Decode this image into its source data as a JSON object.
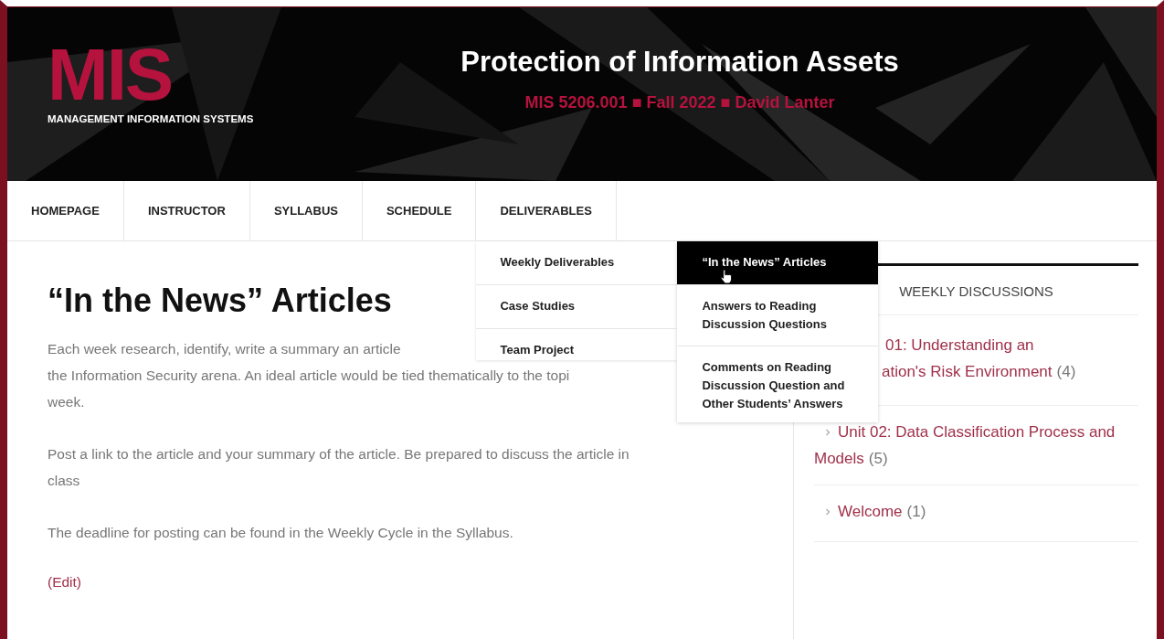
{
  "header": {
    "logo": "MIS",
    "logo_caption": "MANAGEMENT INFORMATION SYSTEMS",
    "title": "Protection of Information Assets",
    "subtitle": "MIS 5206.001 ■ Fall 2022 ■ David Lanter"
  },
  "nav": {
    "items": [
      {
        "label": "HOMEPAGE"
      },
      {
        "label": "INSTRUCTOR"
      },
      {
        "label": "SYLLABUS"
      },
      {
        "label": "SCHEDULE"
      },
      {
        "label": "DELIVERABLES",
        "expanded": true,
        "children": [
          {
            "label": "Weekly Deliverables",
            "expanded": true,
            "children": [
              {
                "label": "“In the News” Articles",
                "selected": true
              },
              {
                "label": "Answers to Reading Discussion Questions",
                "selected": false
              },
              {
                "label": "Comments on Reading Discussion Question and Other Students’ Answers",
                "selected": false
              }
            ]
          },
          {
            "label": "Case Studies"
          },
          {
            "label": "Team Project"
          }
        ]
      }
    ]
  },
  "page": {
    "title": "“In the News” Articles",
    "paragraphs": [
      [
        "Each week research, identify, write a summary an article",
        "the Information Security arena. An ideal article would be tied thematically to the topi",
        "week."
      ],
      [
        "Post a link to the article and your summary of the article. Be prepared to discuss the article in",
        "class"
      ],
      [
        "The deadline for posting can be found in the Weekly Cycle in the Syllabus."
      ]
    ],
    "edit_link": "(Edit)"
  },
  "sidebar": {
    "heading": "WEEKLY DISCUSSIONS",
    "items": [
      {
        "lines": [
          "01: Understanding an",
          "ation's Risk Environment"
        ],
        "count": "(4)",
        "chevron": false
      },
      {
        "lines": [
          "Unit 02: Data Classification Process and",
          "Models"
        ],
        "count": "(5)",
        "chevron": true
      },
      {
        "lines": [
          "Welcome"
        ],
        "count": "(1)",
        "chevron": true
      }
    ]
  }
}
